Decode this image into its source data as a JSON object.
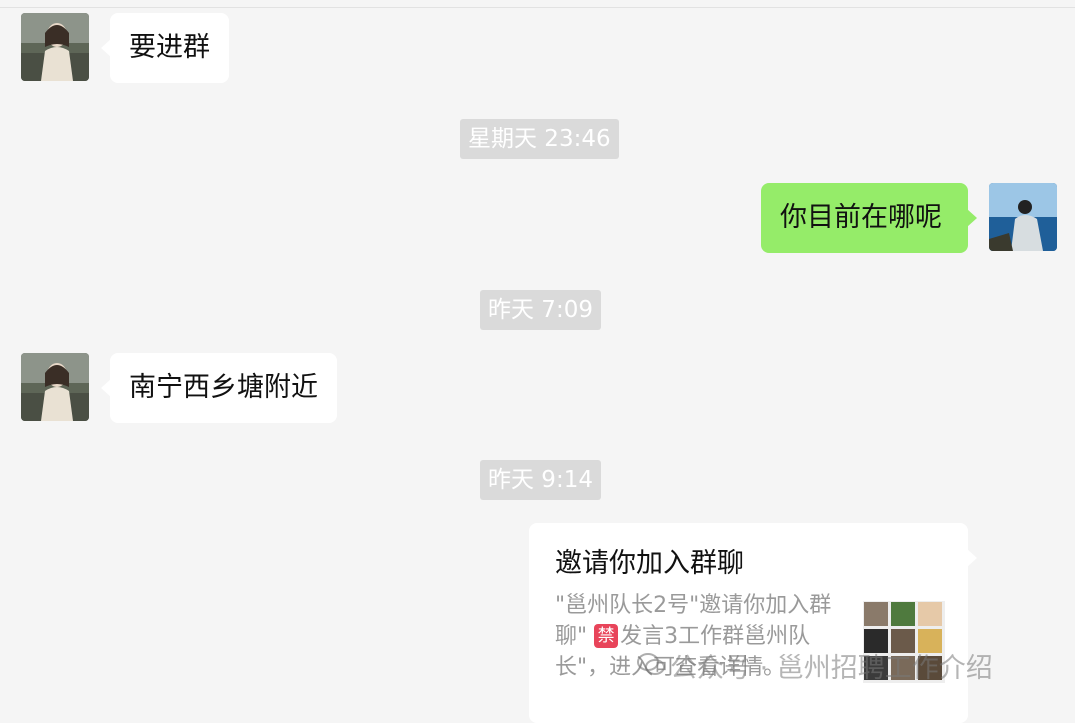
{
  "messages": [
    {
      "sender": "other",
      "text": "要进群"
    },
    {
      "timestamp": "星期天 23:46"
    },
    {
      "sender": "me",
      "text": "你目前在哪呢"
    },
    {
      "timestamp": "昨天 7:09"
    },
    {
      "sender": "other",
      "text": "南宁西乡塘附近"
    },
    {
      "timestamp": "昨天 9:14"
    }
  ],
  "invite_card": {
    "title": "邀请你加入群聊",
    "desc_part1": "\"邕州队长2号\"邀请你加入群聊\"",
    "ban_badge": "禁",
    "desc_part2": "发言3工作群邕州队长\"，进入可查看详情。"
  },
  "watermark": {
    "text": "公众号 · 邕州招聘工作介绍"
  },
  "colors": {
    "background": "#f5f5f5",
    "incoming_bubble": "#ffffff",
    "outgoing_bubble": "#95ec69",
    "timestamp_bg": "#dadada",
    "ban_badge": "#e8445a"
  }
}
